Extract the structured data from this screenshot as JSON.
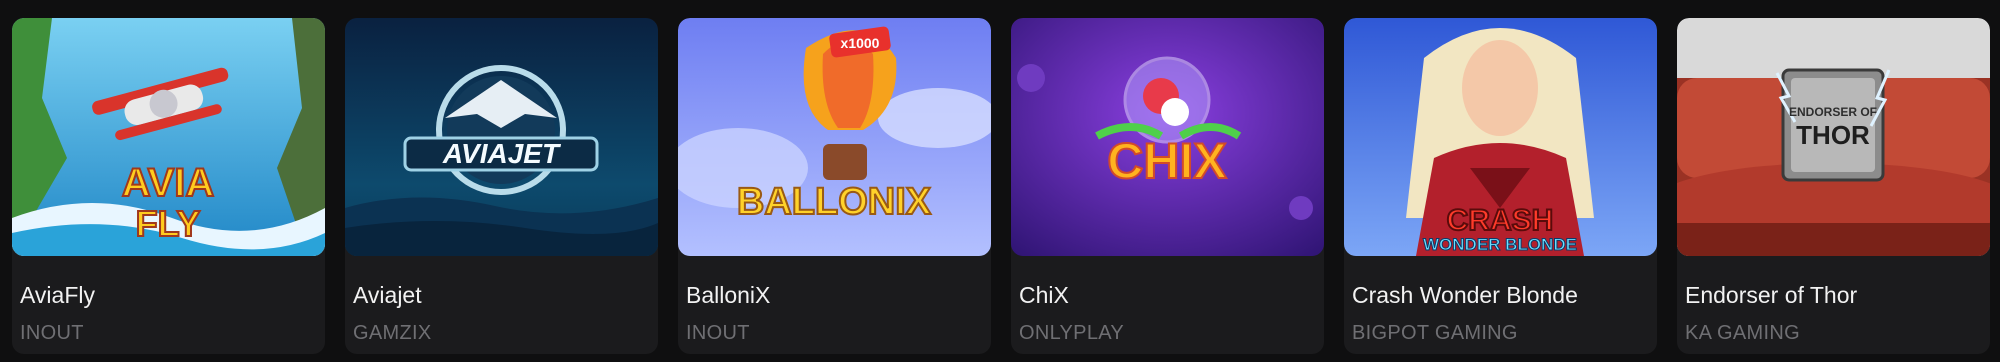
{
  "games": [
    {
      "title": "AviaFly",
      "provider": "INOUT",
      "art_text": [
        "AVIA",
        "FLY"
      ],
      "icon": "airplane-icon",
      "bg": [
        "#6fc7ee",
        "#1b7fc0"
      ]
    },
    {
      "title": "Aviajet",
      "provider": "GAMZIX",
      "art_text": [
        "AVIAJET"
      ],
      "icon": "jet-icon",
      "bg": [
        "#0b2a4a",
        "#0e5a78"
      ]
    },
    {
      "title": "BalloniX",
      "provider": "INOUT",
      "art_text": [
        "BALLONIX",
        "x1000"
      ],
      "icon": "hot-air-balloon-icon",
      "bg": [
        "#6f7af0",
        "#a9b6ff"
      ]
    },
    {
      "title": "ChiX",
      "provider": "ONLYPLAY",
      "art_text": [
        "CHIX"
      ],
      "icon": "chicken-icon",
      "bg": [
        "#3b1a8f",
        "#7b2fd0"
      ]
    },
    {
      "title": "Crash Wonder Blonde",
      "provider": "BIGPOT GAMING",
      "art_text": [
        "CRASH",
        "WONDER BLONDE"
      ],
      "icon": "heroine-icon",
      "bg": [
        "#3a5fd8",
        "#8fb6ff"
      ]
    },
    {
      "title": "Endorser of Thor",
      "provider": "KA GAMING",
      "art_text": [
        "ENDORSER OF",
        "THOR"
      ],
      "icon": "lightning-icon",
      "bg": [
        "#8a3a2a",
        "#c24a38"
      ]
    }
  ]
}
